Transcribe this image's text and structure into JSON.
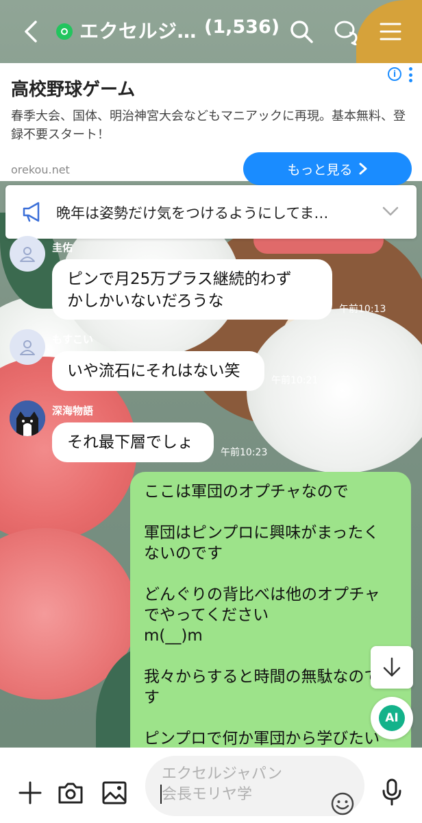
{
  "header": {
    "title": "エクセルジ…",
    "member_count": "(1,536)"
  },
  "ad": {
    "title": "高校野球ゲーム",
    "description": "春季大会、国体、明治神宮大会などもマニアックに再現。基本無料、登録不要スタート！",
    "domain": "orekou.net",
    "more_label": "もっと見る"
  },
  "announcement": {
    "text": "晩年は姿勢だけ気をつけるようにしてま…"
  },
  "messages": [
    {
      "sender": "圭佑",
      "text": "ピンで月25万プラス継続的わず\nかしかいないだろうな",
      "time": "午前10:13"
    },
    {
      "sender": "もすこい",
      "text": "いや流石にそれはない笑",
      "time": "午前10:21"
    },
    {
      "sender": "深海物語",
      "text": "それ最下層でしょ",
      "time": "午前10:23"
    }
  ],
  "my_message": {
    "text": "ここは軍団のオプチャなので\n\n軍団はピンプロに興味がまったく\nないのです\n\nどんぐりの背比べは他のオプチャ\nでやってください\nm(__)m\n\n我々からすると時間の無駄なので\nす\n\nピンプロで何か軍団から学びたい"
  },
  "ai_label": "AI",
  "input": {
    "placeholder": "エクセルジャパン\n会長モリヤ学"
  },
  "colors": {
    "accent_green": "#9de38a",
    "ad_blue": "#1a8cff",
    "openchat_badge": "#22c55e",
    "ai_teal": "#13b28a"
  }
}
